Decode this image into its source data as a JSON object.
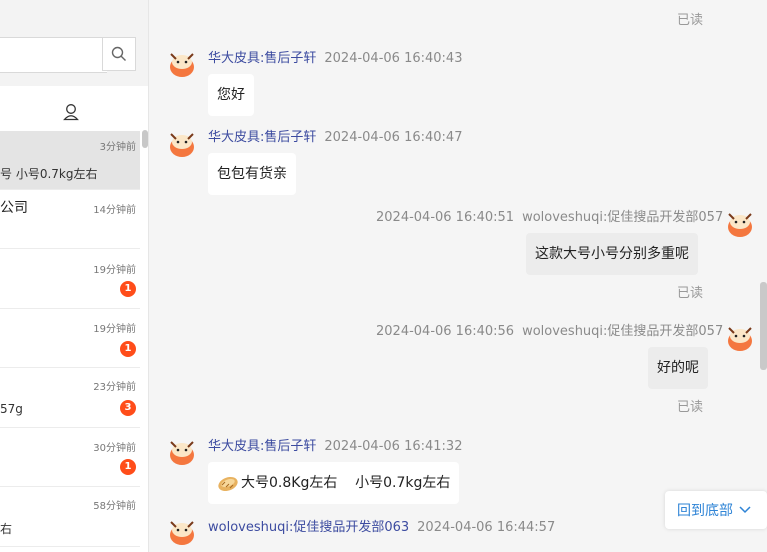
{
  "search": {
    "placeholder": ""
  },
  "conversations": [
    {
      "time": "3分钟前",
      "title": "",
      "preview": "号 小号0.7kg左右",
      "badge": ""
    },
    {
      "time": "14分钟前",
      "title": "公司",
      "preview": "",
      "badge": ""
    },
    {
      "time": "19分钟前",
      "title": "",
      "preview": "",
      "badge": "1"
    },
    {
      "time": "19分钟前",
      "title": "",
      "preview": "",
      "badge": "1"
    },
    {
      "time": "23分钟前",
      "title": "",
      "preview": "57g",
      "badge": "3"
    },
    {
      "time": "30分钟前",
      "title": "",
      "preview": "",
      "badge": "1"
    },
    {
      "time": "58分钟前",
      "title": "",
      "preview": "右",
      "badge": ""
    }
  ],
  "chat": {
    "top_read": "已读",
    "messages": [
      {
        "side": "left",
        "name": "华大皮具:售后子轩",
        "time": "2024-04-06 16:40:43",
        "text": "您好"
      },
      {
        "side": "left",
        "name": "华大皮具:售后子轩",
        "time": "2024-04-06 16:40:47",
        "text": "包包有货亲"
      },
      {
        "side": "right",
        "name": "woloveshuqi:促佳搜品开发部057",
        "time": "2024-04-06 16:40:51",
        "text": "这款大号小号分别多重呢",
        "status": "已读"
      },
      {
        "side": "right",
        "name": "woloveshuqi:促佳搜品开发部057",
        "time": "2024-04-06 16:40:56",
        "text": "好的呢",
        "status": "已读"
      },
      {
        "side": "left",
        "name": "华大皮具:售后子轩",
        "time": "2024-04-06 16:41:32",
        "text": "大号0.8Kg左右    小号0.7kg左右",
        "emoji": "bread-emoji"
      },
      {
        "side": "left",
        "name": "woloveshuqi:促佳搜品开发部063",
        "time": "2024-04-06 16:44:57",
        "text": ""
      }
    ]
  },
  "back_to_bottom": "回到底部",
  "colors": {
    "accent": "#2f84d6",
    "badge": "#ff4d1a",
    "sender_name": "#3c4ba0"
  }
}
